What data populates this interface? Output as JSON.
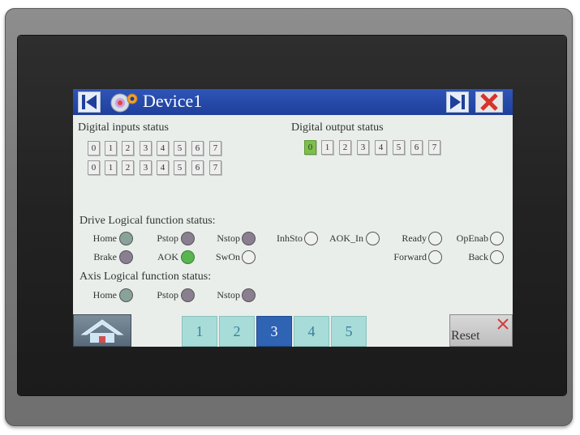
{
  "window": {
    "title": "Device1",
    "prev_icon": "skip-back-icon",
    "next_icon": "skip-forward-icon",
    "close_icon": "close-icon",
    "app_icon": "device-settings-icon"
  },
  "digital_inputs": {
    "title": "Digital inputs status",
    "row1": [
      "0",
      "1",
      "2",
      "3",
      "4",
      "5",
      "6",
      "7"
    ],
    "row2": [
      "0",
      "1",
      "2",
      "3",
      "4",
      "5",
      "6",
      "7"
    ]
  },
  "digital_outputs": {
    "title": "Digital output status",
    "bits": [
      "0",
      "1",
      "2",
      "3",
      "4",
      "5",
      "6",
      "7"
    ],
    "active_bit": "0"
  },
  "drive_status": {
    "title": "Drive Logical function status:",
    "items": [
      {
        "label": "Home",
        "state": "grey"
      },
      {
        "label": "Pstop",
        "state": "purple"
      },
      {
        "label": "Nstop",
        "state": "purple"
      },
      {
        "label": "InhSto",
        "state": "off"
      },
      {
        "label": "AOK_In",
        "state": "off"
      },
      {
        "label": "Ready",
        "state": "off"
      },
      {
        "label": "OpEnab",
        "state": "off"
      },
      {
        "label": "Brake",
        "state": "purple"
      },
      {
        "label": "AOK",
        "state": "green"
      },
      {
        "label": "SwOn",
        "state": "off"
      },
      {
        "label": "Forward",
        "state": "off"
      },
      {
        "label": "Back",
        "state": "off"
      }
    ]
  },
  "axis_status": {
    "title": "Axis Logical function status:",
    "items": [
      {
        "label": "Home",
        "state": "grey"
      },
      {
        "label": "Pstop",
        "state": "purple"
      },
      {
        "label": "Nstop",
        "state": "purple"
      }
    ]
  },
  "bottom_bar": {
    "home_icon": "home-icon",
    "tabs": [
      "1",
      "2",
      "3",
      "4",
      "5"
    ],
    "active_tab": "3",
    "reset_label": "Reset",
    "reset_icon": "close-icon"
  },
  "colors": {
    "titlebar": "#1f3f9a",
    "tab": "#a7dcd8",
    "tab_active": "#2f63b3",
    "led_green": "#58b54f",
    "bit_on": "#7cc04b"
  }
}
